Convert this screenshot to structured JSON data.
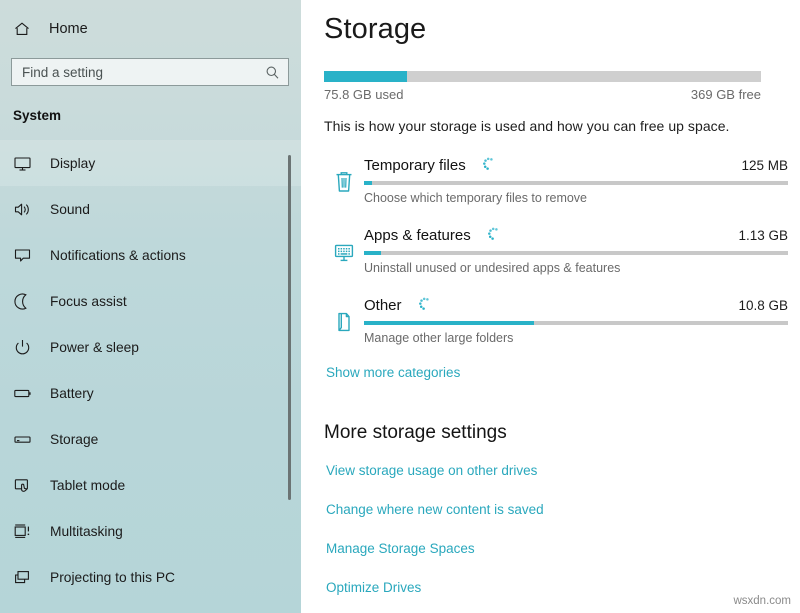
{
  "sidebar": {
    "home": {
      "label": "Home",
      "icon": "home-icon"
    },
    "search": {
      "placeholder": "Find a setting",
      "value": "",
      "icon": "search-icon"
    },
    "section_title": "System",
    "items": [
      {
        "label": "Display",
        "icon": "monitor-icon",
        "state": "hover"
      },
      {
        "label": "Sound",
        "icon": "speaker-icon",
        "state": "normal"
      },
      {
        "label": "Notifications & actions",
        "icon": "notification-icon",
        "state": "normal"
      },
      {
        "label": "Focus assist",
        "icon": "moon-icon",
        "state": "normal"
      },
      {
        "label": "Power & sleep",
        "icon": "power-icon",
        "state": "normal"
      },
      {
        "label": "Battery",
        "icon": "battery-icon",
        "state": "normal"
      },
      {
        "label": "Storage",
        "icon": "drive-icon",
        "state": "normal"
      },
      {
        "label": "Tablet mode",
        "icon": "tablet-icon",
        "state": "normal"
      },
      {
        "label": "Multitasking",
        "icon": "multitasking-icon",
        "state": "normal"
      },
      {
        "label": "Projecting to this PC",
        "icon": "project-icon",
        "state": "normal"
      }
    ]
  },
  "main": {
    "title": "Storage",
    "drive": {
      "used_label": "75.8 GB used",
      "free_label": "369 GB free",
      "used_percent": 19
    },
    "intro": "This is how your storage is used and how you can free up space.",
    "categories": [
      {
        "name": "Temporary files",
        "size": "125 MB",
        "subtitle": "Choose which temporary files to remove",
        "icon": "trash-icon",
        "percent": 2,
        "spinner": "loading-spinner-icon"
      },
      {
        "name": "Apps & features",
        "size": "1.13 GB",
        "subtitle": "Uninstall unused or undesired apps & features",
        "icon": "apps-monitor-icon",
        "percent": 4,
        "spinner": "loading-spinner-icon"
      },
      {
        "name": "Other",
        "size": "10.8 GB",
        "subtitle": "Manage other large folders",
        "icon": "folder-icon",
        "percent": 40,
        "spinner": "loading-spinner-icon"
      }
    ],
    "show_more": "Show more categories",
    "more_settings_title": "More storage settings",
    "more_links": [
      "View storage usage on other drives",
      "Change where new content is saved",
      "Manage Storage Spaces",
      "Optimize Drives"
    ]
  },
  "watermark": "wsxdn.com",
  "colors": {
    "accent": "#29b2c8",
    "link": "#2aa8bd",
    "sidebar_bg": "#c3d9da",
    "track": "#cfcfcf"
  }
}
